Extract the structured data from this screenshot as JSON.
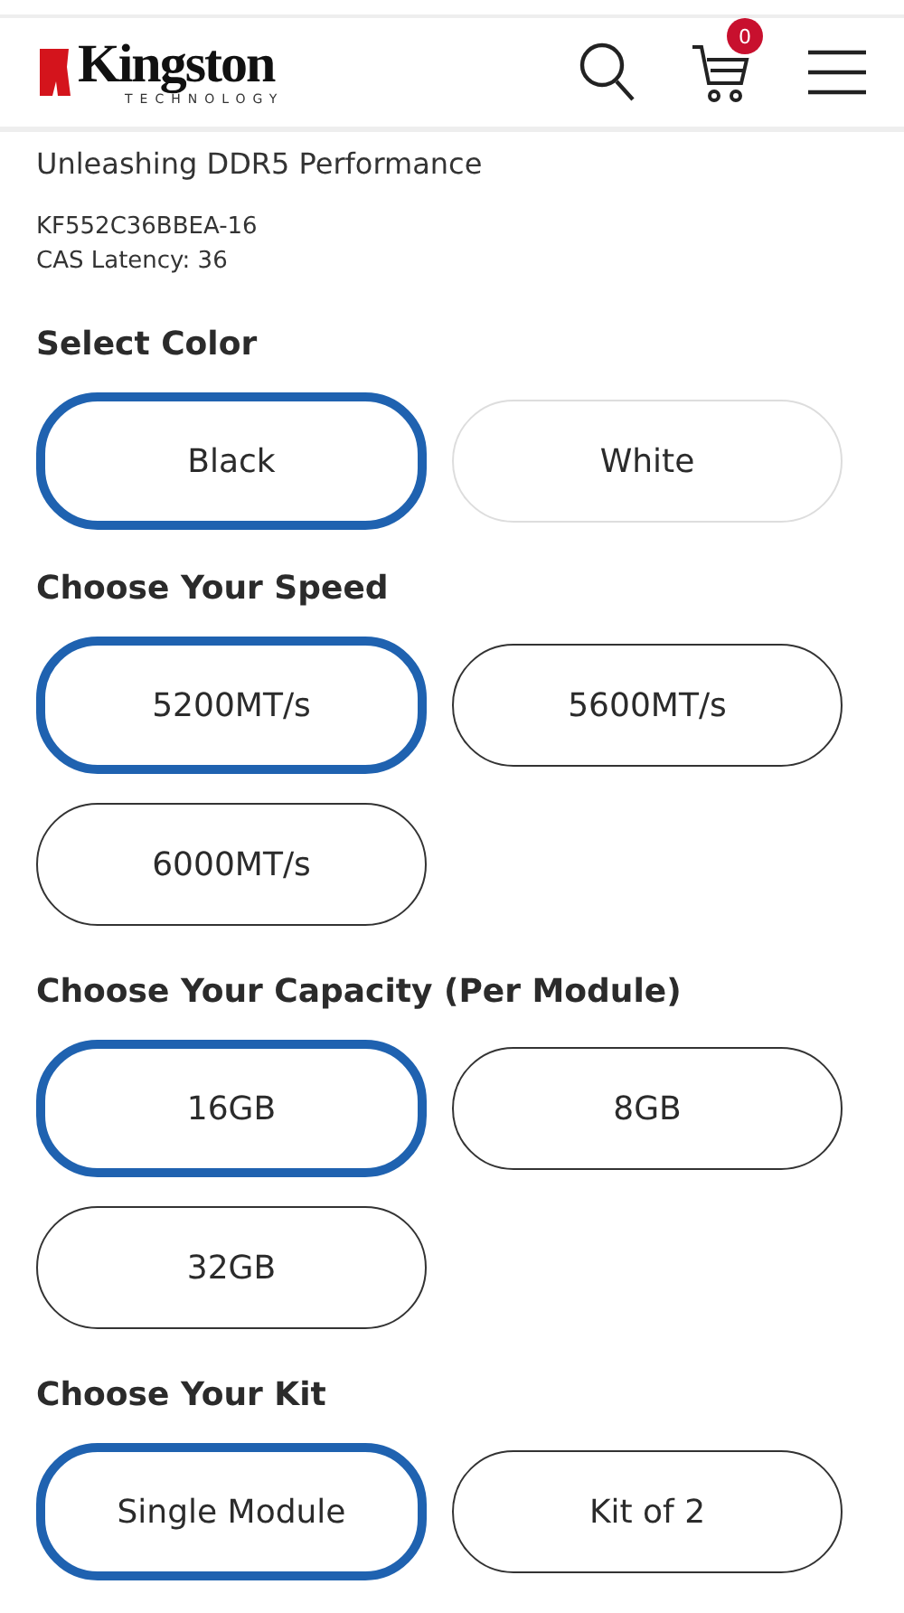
{
  "header": {
    "logo": {
      "name": "Kingston",
      "tagline": "TECHNOLOGY"
    },
    "cart_count": "0"
  },
  "product": {
    "tagline": "Unleashing DDR5 Performance",
    "part_number": "KF552C36BBEA-16",
    "cas_latency": "CAS Latency: 36"
  },
  "sections": [
    {
      "title": "Select Color",
      "options": [
        {
          "label": "Black",
          "selected": true,
          "available": true
        },
        {
          "label": "White",
          "selected": false,
          "available": false
        }
      ]
    },
    {
      "title": "Choose Your Speed",
      "options": [
        {
          "label": "5200MT/s",
          "selected": true,
          "available": true
        },
        {
          "label": "5600MT/s",
          "selected": false,
          "available": true
        },
        {
          "label": "6000MT/s",
          "selected": false,
          "available": true
        }
      ]
    },
    {
      "title": "Choose Your Capacity (Per Module)",
      "options": [
        {
          "label": "16GB",
          "selected": true,
          "available": true
        },
        {
          "label": "8GB",
          "selected": false,
          "available": true
        },
        {
          "label": "32GB",
          "selected": false,
          "available": true
        }
      ]
    },
    {
      "title": "Choose Your Kit",
      "options": [
        {
          "label": "Single Module",
          "selected": true,
          "available": true
        },
        {
          "label": "Kit of 2",
          "selected": false,
          "available": true
        }
      ]
    }
  ]
}
